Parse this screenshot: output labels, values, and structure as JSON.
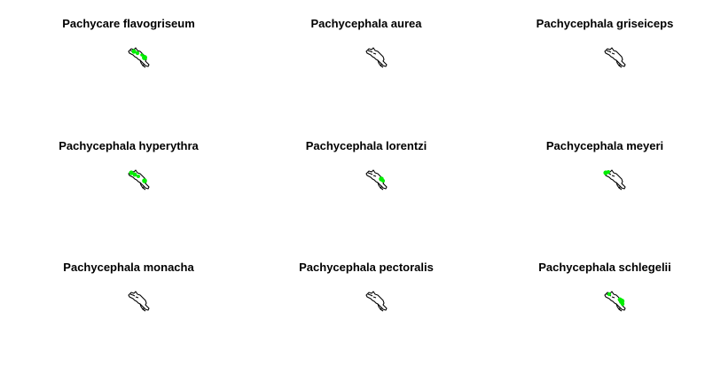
{
  "colors": {
    "background": "#ffffff",
    "outline": "#000000",
    "range": "#00ee00"
  },
  "panels": [
    {
      "species": "Pachycare flavogriseum",
      "range_icon": "range-west"
    },
    {
      "species": "Pachycephala aurea",
      "range_icon": "none"
    },
    {
      "species": "Pachycephala griseiceps",
      "range_icon": "none"
    },
    {
      "species": "Pachycephala hyperythra",
      "range_icon": "range-wide"
    },
    {
      "species": "Pachycephala lorentzi",
      "range_icon": "range-central"
    },
    {
      "species": "Pachycephala meyeri",
      "range_icon": "range-far-west"
    },
    {
      "species": "Pachycephala monacha",
      "range_icon": "none"
    },
    {
      "species": "Pachycephala pectoralis",
      "range_icon": "none"
    },
    {
      "species": "Pachycephala schlegelii",
      "range_icon": "range-east"
    }
  ]
}
